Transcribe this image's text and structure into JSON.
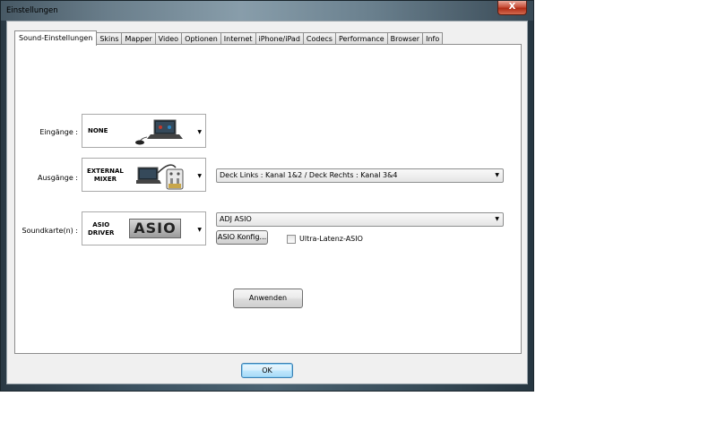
{
  "window": {
    "title": "Einstellungen",
    "close_label": "X"
  },
  "tabs": [
    {
      "label": "Sound-Einstellungen",
      "active": true
    },
    {
      "label": "Skins"
    },
    {
      "label": "Mapper"
    },
    {
      "label": "Video"
    },
    {
      "label": "Optionen"
    },
    {
      "label": "Internet"
    },
    {
      "label": "iPhone/iPad"
    },
    {
      "label": "Codecs"
    },
    {
      "label": "Performance"
    },
    {
      "label": "Browser"
    },
    {
      "label": "Info"
    }
  ],
  "sound": {
    "inputs": {
      "label": "Eingänge :",
      "value": "NONE",
      "icon": "laptop-with-mouse-icon"
    },
    "outputs": {
      "label": "Ausgänge :",
      "value_line1": "EXTERNAL",
      "value_line2": "MIXER",
      "icon": "laptop-with-mixer-icon",
      "routing": "Deck Links : Kanal 1&2 / Deck Rechts : Kanal 3&4"
    },
    "soundcard": {
      "label": "Soundkarte(n) :",
      "value_line1": "ASIO",
      "value_line2": "DRIVER",
      "logo_text": "ASIO",
      "device": "ADJ ASIO",
      "config_button": "ASIO Konfig...",
      "ultra_latency_label": "Ultra-Latenz-ASIO",
      "ultra_latency_checked": false
    },
    "apply_button": "Anwenden"
  },
  "ok_button": "OK",
  "colors": {
    "tab_panel": "#ffffff",
    "client_bg": "#f0f0f0",
    "close_red": "#c8503a",
    "default_button_border": "#3c7fb1"
  }
}
